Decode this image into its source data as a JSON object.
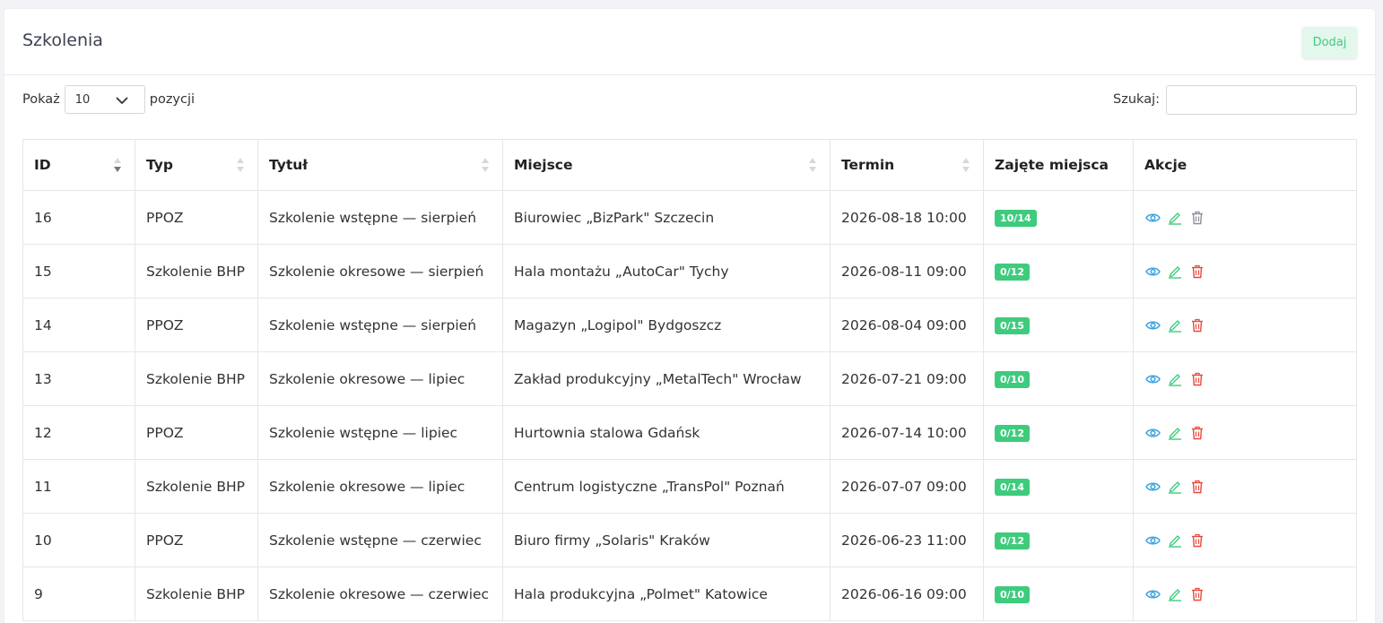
{
  "page": {
    "title": "Szkolenia",
    "add_label": "Dodaj",
    "show_label": "Pokaż",
    "page_size": "10",
    "entries_label": "pozycji",
    "search_label": "Szukaj:",
    "search_value": ""
  },
  "table": {
    "columns": [
      "ID",
      "Typ",
      "Tytuł",
      "Miejsce",
      "Termin",
      "Zajęte miejsca",
      "Akcje"
    ],
    "rows": [
      {
        "id": "16",
        "type": "PPOZ",
        "title": "Szkolenie wstępne — sierpień",
        "place": "Biurowiec „BizPark\" Szczecin",
        "date": "2026-08-18 10:00",
        "seats": "10/14",
        "delete_disabled": true
      },
      {
        "id": "15",
        "type": "Szkolenie BHP",
        "title": "Szkolenie okresowe — sierpień",
        "place": "Hala montażu „AutoCar\" Tychy",
        "date": "2026-08-11 09:00",
        "seats": "0/12",
        "delete_disabled": false
      },
      {
        "id": "14",
        "type": "PPOZ",
        "title": "Szkolenie wstępne — sierpień",
        "place": "Magazyn „Logipol\" Bydgoszcz",
        "date": "2026-08-04 09:00",
        "seats": "0/15",
        "delete_disabled": false
      },
      {
        "id": "13",
        "type": "Szkolenie BHP",
        "title": "Szkolenie okresowe — lipiec",
        "place": "Zakład produkcyjny „MetalTech\" Wrocław",
        "date": "2026-07-21 09:00",
        "seats": "0/10",
        "delete_disabled": false
      },
      {
        "id": "12",
        "type": "PPOZ",
        "title": "Szkolenie wstępne — lipiec",
        "place": "Hurtownia stalowa Gdańsk",
        "date": "2026-07-14 10:00",
        "seats": "0/12",
        "delete_disabled": false
      },
      {
        "id": "11",
        "type": "Szkolenie BHP",
        "title": "Szkolenie okresowe — lipiec",
        "place": "Centrum logistyczne „TransPol\" Poznań",
        "date": "2026-07-07 09:00",
        "seats": "0/14",
        "delete_disabled": false
      },
      {
        "id": "10",
        "type": "PPOZ",
        "title": "Szkolenie wstępne — czerwiec",
        "place": "Biuro firmy „Solaris\" Kraków",
        "date": "2026-06-23 11:00",
        "seats": "0/12",
        "delete_disabled": false
      },
      {
        "id": "9",
        "type": "Szkolenie BHP",
        "title": "Szkolenie okresowe — czerwiec",
        "place": "Hala produkcyjna „Polmet\" Katowice",
        "date": "2026-06-16 09:00",
        "seats": "0/10",
        "delete_disabled": false
      }
    ]
  },
  "colors": {
    "accent_green": "#3fcb7d",
    "view_icon": "#3aa3dd",
    "edit_icon": "#3fcb7d",
    "delete_icon": "#e8493c",
    "delete_disabled_icon": "#8a8f98"
  },
  "icons": {
    "view": "eye-icon",
    "edit": "pencil-icon",
    "delete": "trash-icon",
    "sort": "sort-arrows-icon",
    "dropdown": "chevron-down-icon"
  }
}
